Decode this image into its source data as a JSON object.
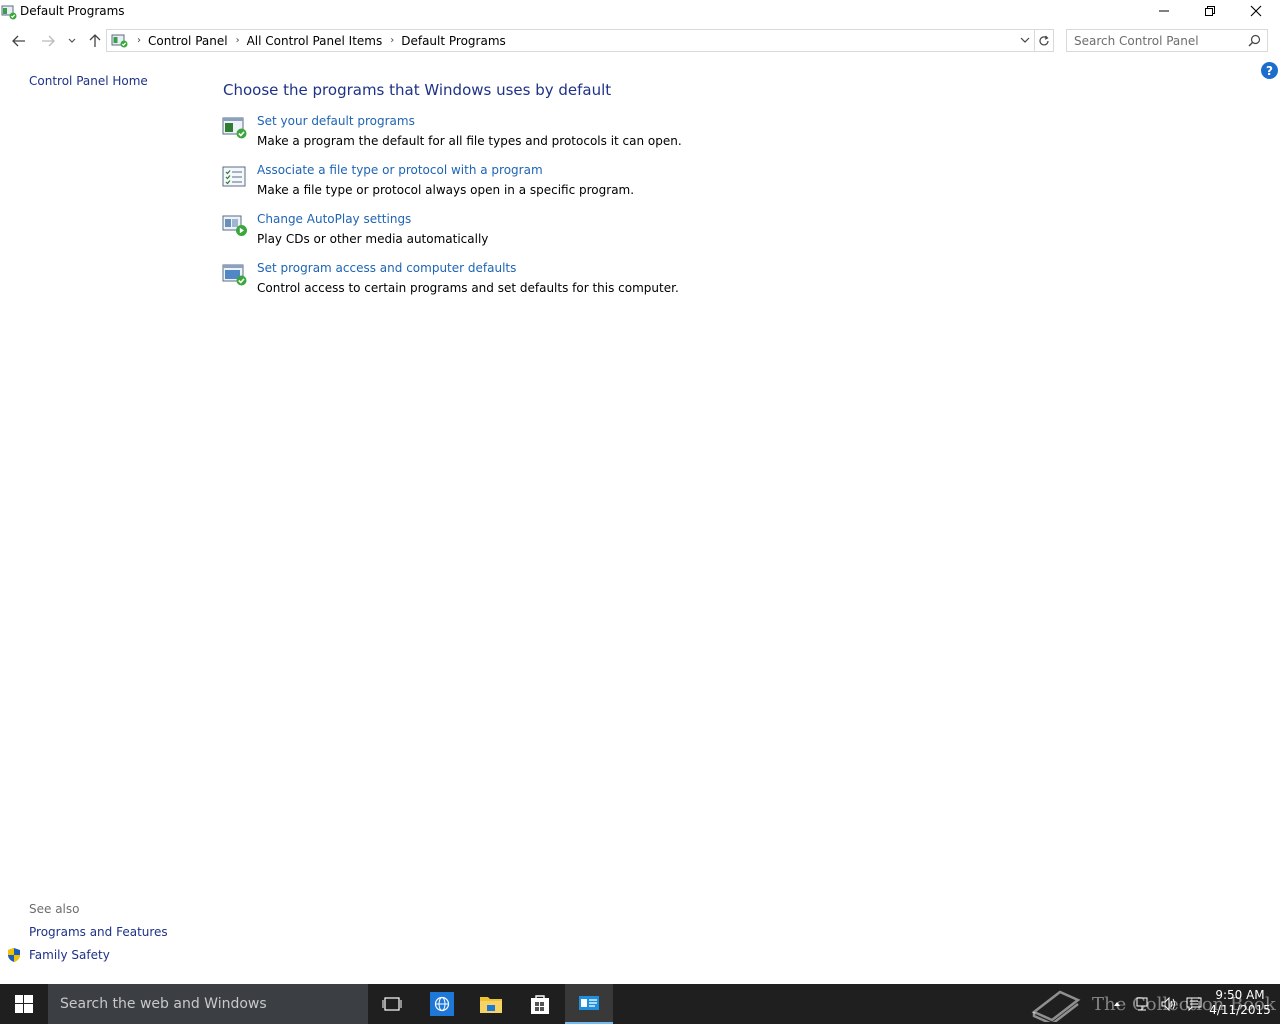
{
  "window": {
    "title": "Default Programs"
  },
  "address": {
    "crumbs": [
      "Control Panel",
      "All Control Panel Items",
      "Default Programs"
    ]
  },
  "search": {
    "placeholder": "Search Control Panel"
  },
  "left": {
    "home_link": "Control Panel Home",
    "see_also_label": "See also",
    "see_also": [
      "Programs and Features",
      "Family Safety"
    ]
  },
  "main": {
    "heading": "Choose the programs that Windows uses by default",
    "tasks": [
      {
        "link": "Set your default programs",
        "desc": "Make a program the default for all file types and protocols it can open.",
        "icon": "default-programs-icon"
      },
      {
        "link": "Associate a file type or protocol with a program",
        "desc": "Make a file type or protocol always open in a specific program.",
        "icon": "file-association-icon"
      },
      {
        "link": "Change AutoPlay settings",
        "desc": "Play CDs or other media automatically",
        "icon": "autoplay-icon"
      },
      {
        "link": "Set program access and computer defaults",
        "desc": "Control access to certain programs and set defaults for this computer.",
        "icon": "program-access-icon"
      }
    ]
  },
  "help": {
    "label": "?"
  },
  "taskbar": {
    "search_text": "Search the web and Windows",
    "time": "9:50 AM",
    "date": "4/11/2015",
    "watermark": "The Collection Book"
  },
  "colors": {
    "link": "#1e64b4",
    "heading": "#1e3287",
    "taskbar": "#1f1f1f",
    "taskbar_search": "#3b3f44",
    "accent": "#76b9ed"
  }
}
